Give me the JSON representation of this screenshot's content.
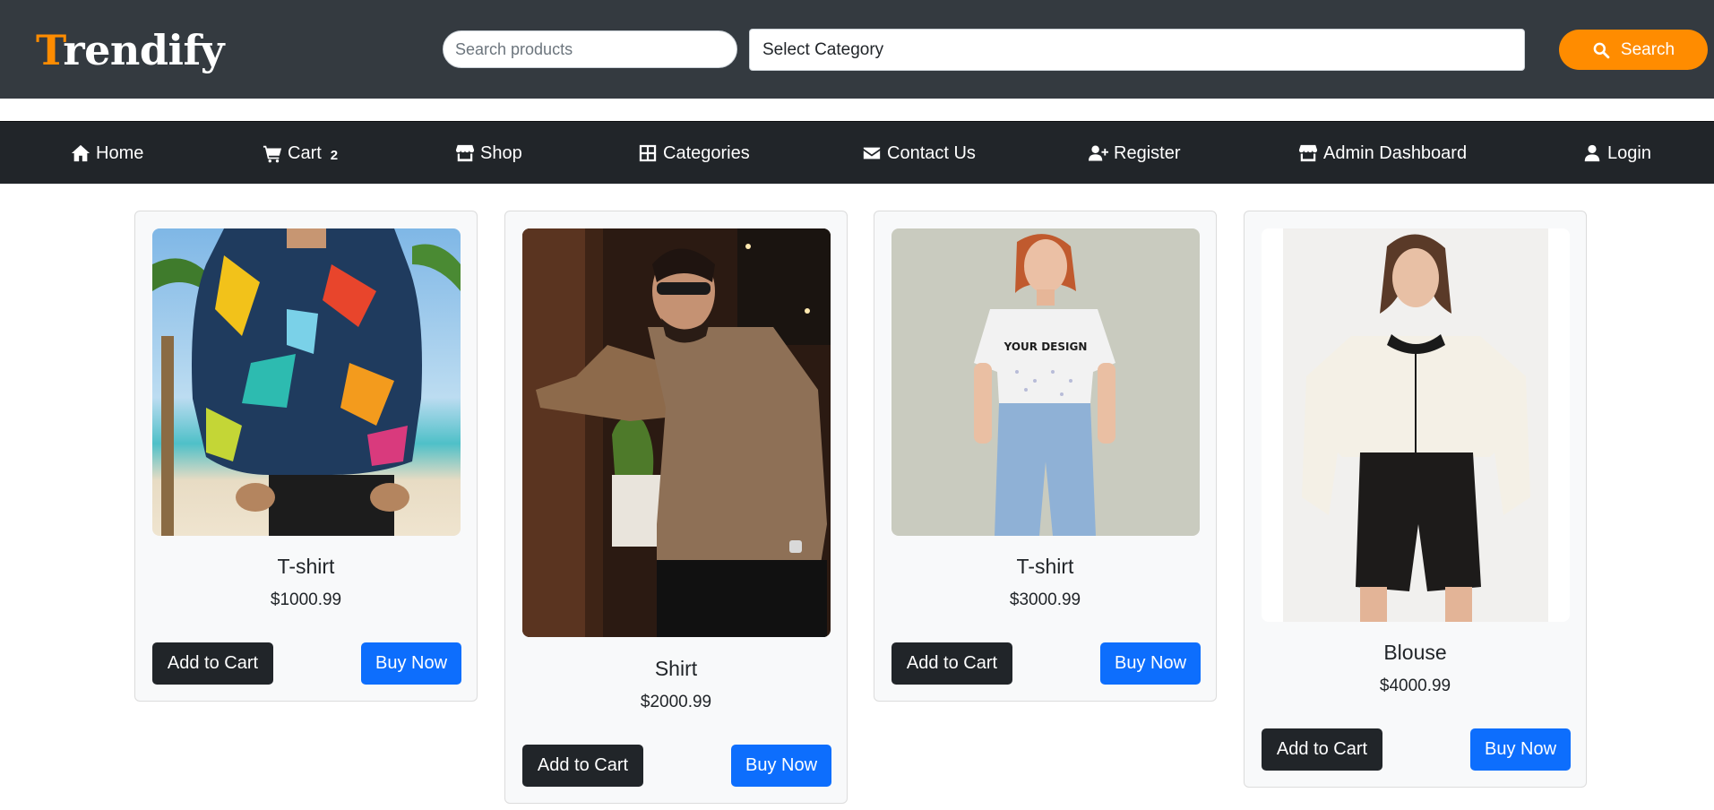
{
  "header": {
    "logo_first_letter": "T",
    "logo_rest": "rendify",
    "search": {
      "placeholder": "Search products",
      "value": ""
    },
    "category_select": {
      "selected": "Select Category"
    },
    "search_button_label": "Search",
    "colors": {
      "header_bg": "#343a40",
      "accent": "#ff8c00"
    }
  },
  "nav": {
    "items": [
      {
        "label": "Home",
        "icon": "home-icon"
      },
      {
        "label": "Cart",
        "icon": "cart-icon",
        "badge": "2"
      },
      {
        "label": "Shop",
        "icon": "store-icon"
      },
      {
        "label": "Categories",
        "icon": "grid-icon"
      },
      {
        "label": "Contact Us",
        "icon": "envelope-icon"
      },
      {
        "label": "Register",
        "icon": "user-plus-icon"
      },
      {
        "label": "Admin Dashboard",
        "icon": "store-icon"
      },
      {
        "label": "Login",
        "icon": "user-icon"
      }
    ]
  },
  "products": [
    {
      "name": "T-shirt",
      "price": "$1000.99",
      "image": "man in tropical print shirt on beach",
      "add_label": "Add to Cart",
      "buy_label": "Buy Now"
    },
    {
      "name": "Shirt",
      "price": "$2000.99",
      "image": "man in brown button shirt with sunglasses",
      "add_label": "Add to Cart",
      "buy_label": "Buy Now"
    },
    {
      "name": "T-shirt",
      "price": "$3000.99",
      "image": "woman in white graphic t-shirt and jeans",
      "add_label": "Add to Cart",
      "buy_label": "Buy Now"
    },
    {
      "name": "Blouse",
      "price": "$4000.99",
      "image": "woman in white blouse and black leather shorts",
      "add_label": "Add to Cart",
      "buy_label": "Buy Now"
    }
  ],
  "product_image_text": {
    "tshirt_print": "YOUR DESIGN"
  },
  "button_colors": {
    "add_to_cart": "#212529",
    "buy_now": "#0d6efd"
  }
}
